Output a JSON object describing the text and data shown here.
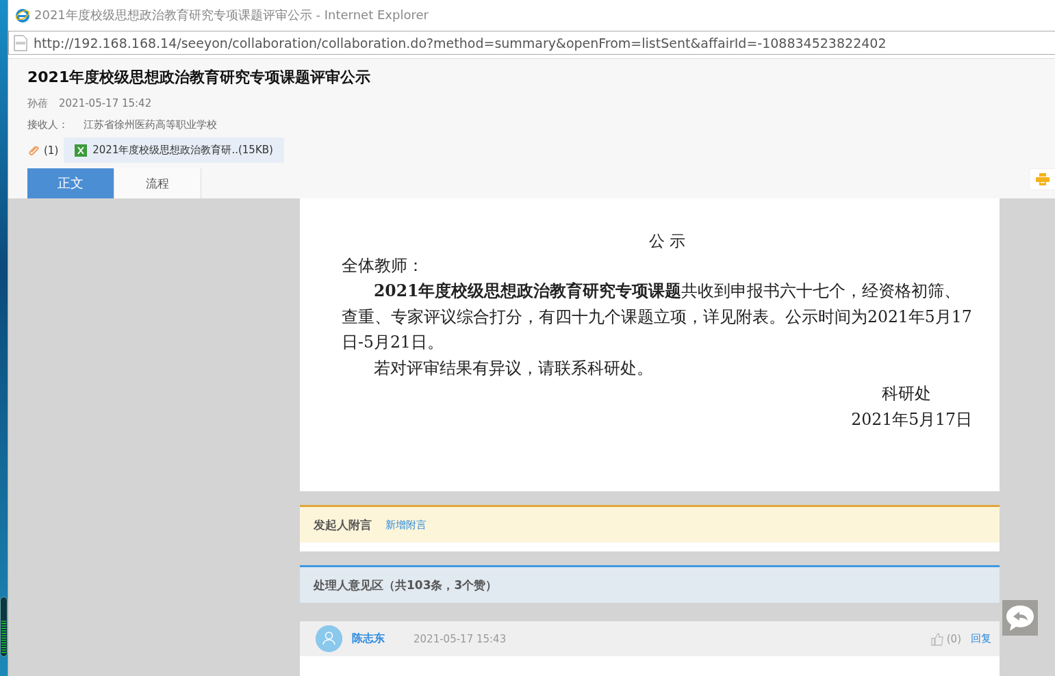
{
  "window": {
    "title": "2021年度校级思想政治教育研究专项课题评审公示 - Internet Explorer",
    "url": "http://192.168.168.14/seeyon/collaboration/collaboration.do?method=summary&openFrom=listSent&affairId=-108834523822402"
  },
  "header": {
    "title": "2021年度校级思想政治教育研究专项课题评审公示",
    "sender": "孙蓓",
    "time": "2021-05-17 15:42",
    "receiver_label": "接收人：",
    "receiver": "江苏省徐州医药高等职业学校",
    "attachment_count": "(1)",
    "attachment": "2021年度校级思想政治教育研..(15KB)"
  },
  "tabs": [
    {
      "label": "正文",
      "selected": true
    },
    {
      "label": "流程",
      "selected": false
    }
  ],
  "document": {
    "heading": "公 示",
    "salutation": "全体教师：",
    "paragraphs": [
      "**2021年度校级思想政治教育研究专项课题**共收到申报书六十七个，经资格初筛、查重、专家评议综合打分，有四十九个课题立项，详见附表。公示时间为2021年5月17日-5月21日。",
      "若对评审结果有异议，请联系科研处。"
    ],
    "signature": "科研处",
    "date": "2021年5月17日"
  },
  "sender_note": {
    "title": "发起人附言",
    "link": "新增附言"
  },
  "opinions": {
    "title": "处理人意见区（共103条，3个赞）",
    "items": [
      {
        "name": "陈志东",
        "time": "2021-05-17 15:43",
        "likes": "(0)",
        "reply": "回复"
      }
    ]
  }
}
